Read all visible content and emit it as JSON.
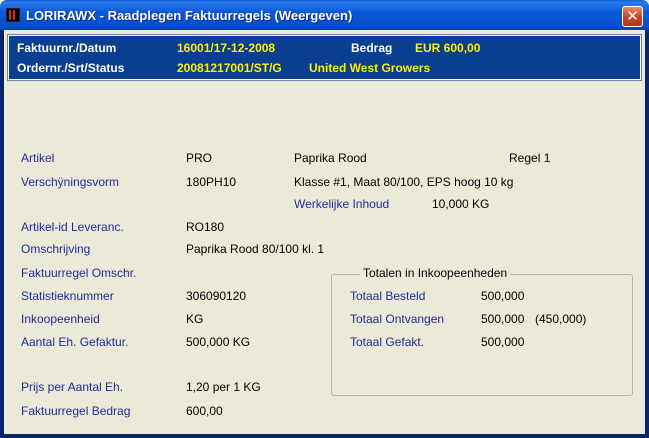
{
  "window": {
    "title": "LORIRAWX - Raadplegen Faktuurregels (Weergeven)",
    "close_symbol": "✕"
  },
  "header": {
    "row1": {
      "label": "Faktuurnr./Datum",
      "value": "16001/17-12-2008",
      "label2": "Bedrag",
      "value2": "EUR 600,00"
    },
    "row2": {
      "label": "Ordernr./Srt/Status",
      "value": "20081217001/ST/G",
      "value2": "United West Growers"
    }
  },
  "fields": {
    "artikel": {
      "label": "Artikel",
      "code": "PRO",
      "name": "Paprika Rood",
      "regel": "Regel 1"
    },
    "verschijningsvorm": {
      "label": "Verschÿningsvorm",
      "code": "180PH10",
      "desc": "Klasse #1, Maat 80/100, EPS hoog 10 kg"
    },
    "werkelijke_inhoud": {
      "label": "Werkelijke Inhoud",
      "value": "10,000 KG"
    },
    "artikel_id": {
      "label": "Artikel-id Leveranc.",
      "value": "RO180"
    },
    "omschrijving": {
      "label": "Omschrijving",
      "value": "Paprika Rood 80/100 kl. 1"
    },
    "faktuurregel_omschr": {
      "label": "Faktuurregel Omschr.",
      "value": ""
    },
    "statistieknummer": {
      "label": "Statistieknummer",
      "value": "306090120"
    },
    "inkoopeenheid": {
      "label": "Inkoopeenheid",
      "value": "KG"
    },
    "aantal_gefaktur": {
      "label": "Aantal Eh. Gefaktur.",
      "value": "500,000 KG"
    },
    "prijs": {
      "label": "Prijs per Aantal Eh.",
      "value": "1,20 per 1 KG"
    },
    "faktuurregel_bedrag": {
      "label": "Faktuurregel Bedrag",
      "value": "600,00"
    }
  },
  "totals": {
    "title": "Totalen in Inkoopeenheden",
    "besteld": {
      "label": "Totaal Besteld",
      "value": "500,000"
    },
    "ontvangen": {
      "label": "Totaal Ontvangen",
      "value": "500,000",
      "extra": "(450,000)"
    },
    "gefakt": {
      "label": "Totaal Gefakt.",
      "value": "500,000"
    }
  },
  "colors": {
    "titlebar": "#0B58D8",
    "header_panel": "#0A3E90",
    "header_value": "#FFF200",
    "label_blue": "#1F2A9C",
    "background": "#ECE9D8"
  }
}
